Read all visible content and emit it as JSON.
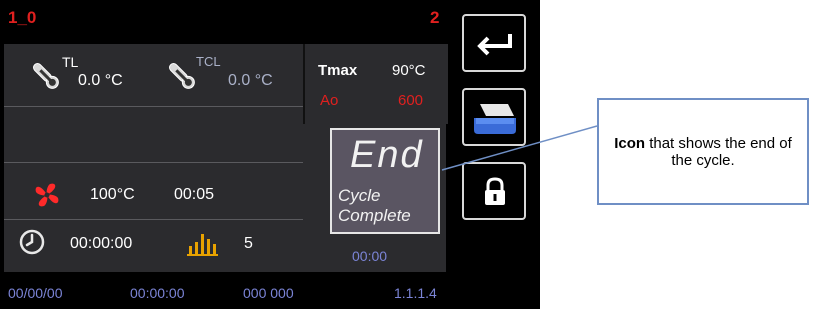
{
  "header": {
    "left_code": "1_0",
    "right_code": "2"
  },
  "temps": {
    "tl_label": "TL",
    "tl_value": "0.0 °C",
    "tcl_label": "TCL",
    "tcl_value": "0.0 °C"
  },
  "limits": {
    "tmax_label": "Tmax",
    "tmax_value": "90°C",
    "ao_label": "Ao",
    "ao_value": "600"
  },
  "program": {
    "temperature": "100°C",
    "duration": "00:05"
  },
  "status": {
    "end_text": "End",
    "cycle_line1": "Cycle",
    "cycle_line2": "Complete",
    "remaining": "00:00"
  },
  "counters": {
    "elapsed": "00:00:00",
    "cycle_count": "5"
  },
  "footer": {
    "date": "00/00/00",
    "time": "00:00:00",
    "codes": "000 000",
    "version": "1.1.1.4"
  },
  "callout": {
    "bold": "Icon",
    "text": " that shows the end of the cycle."
  },
  "icons": {
    "back": "back-arrow-icon",
    "tray": "printer-icon",
    "lock": "lock-icon",
    "thermo": "thermometer-icon",
    "fan": "fan-icon",
    "clock": "clock-icon",
    "bars": "bar-chart-icon"
  },
  "colors": {
    "accent_red": "#e0201f",
    "panel": "#2b2b2e",
    "callout_border": "#6f8fc5"
  }
}
